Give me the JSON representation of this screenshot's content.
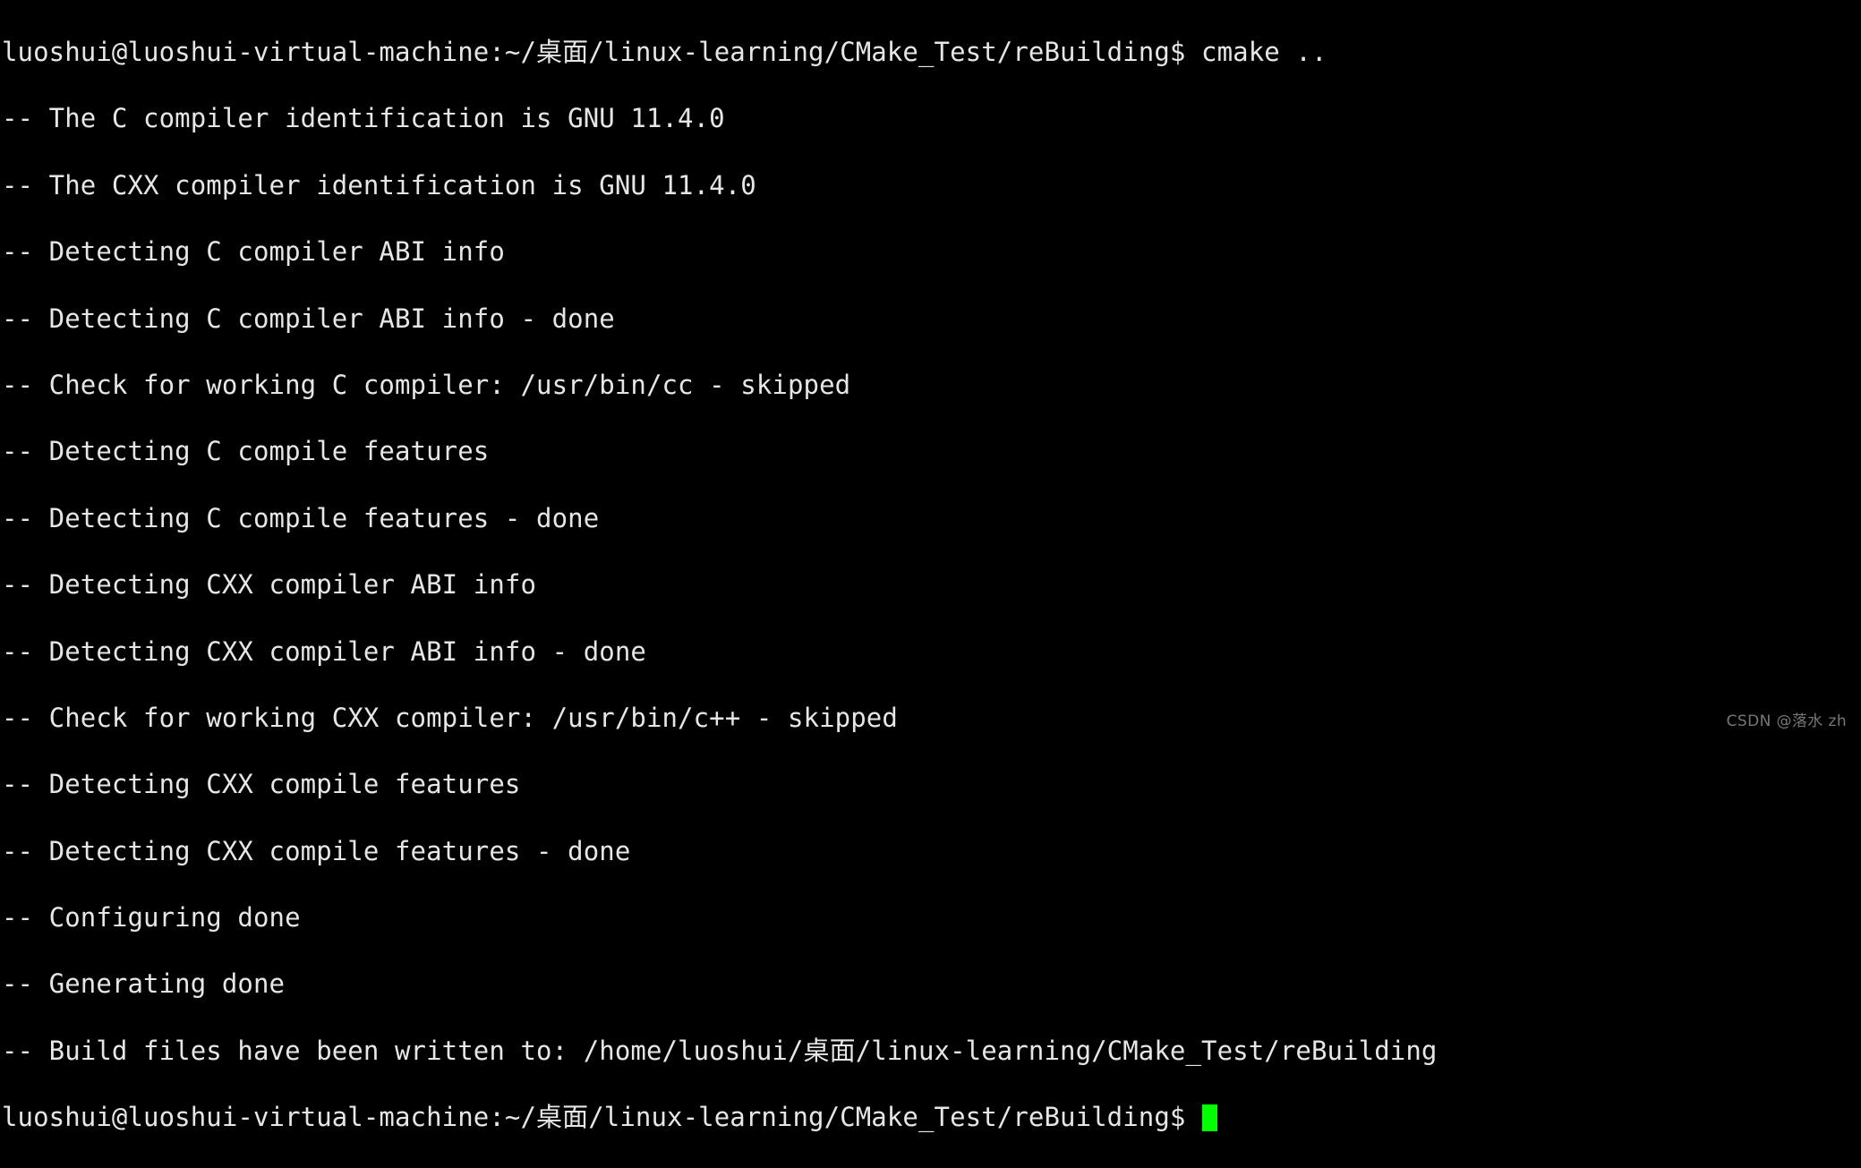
{
  "terminal": {
    "background_color": "#000000",
    "text_color": "#e6e6e6",
    "cursor_color": "#00ff00",
    "prompt_user_host": "luoshui@luoshui-virtual-machine",
    "prompt_path": ":~/桌面/linux-learning/CMake_Test/reBuilding",
    "prompt_symbol": "$ ",
    "command": "cmake ..",
    "lines": [
      "luoshui@luoshui-virtual-machine:~/桌面/linux-learning/CMake_Test/reBuilding$ cmake ..",
      "-- The C compiler identification is GNU 11.4.0",
      "-- The CXX compiler identification is GNU 11.4.0",
      "-- Detecting C compiler ABI info",
      "-- Detecting C compiler ABI info - done",
      "-- Check for working C compiler: /usr/bin/cc - skipped",
      "-- Detecting C compile features",
      "-- Detecting C compile features - done",
      "-- Detecting CXX compiler ABI info",
      "-- Detecting CXX compiler ABI info - done",
      "-- Check for working CXX compiler: /usr/bin/c++ - skipped",
      "-- Detecting CXX compile features",
      "-- Detecting CXX compile features - done",
      "-- Configuring done",
      "-- Generating done",
      "-- Build files have been written to: /home/luoshui/桌面/linux-learning/CMake_Test/reBuilding"
    ],
    "final_prompt": "luoshui@luoshui-virtual-machine:~/桌面/linux-learning/CMake_Test/reBuilding$ "
  },
  "watermark": {
    "text": "CSDN @落水 zh",
    "color": "#8c8c8c"
  }
}
